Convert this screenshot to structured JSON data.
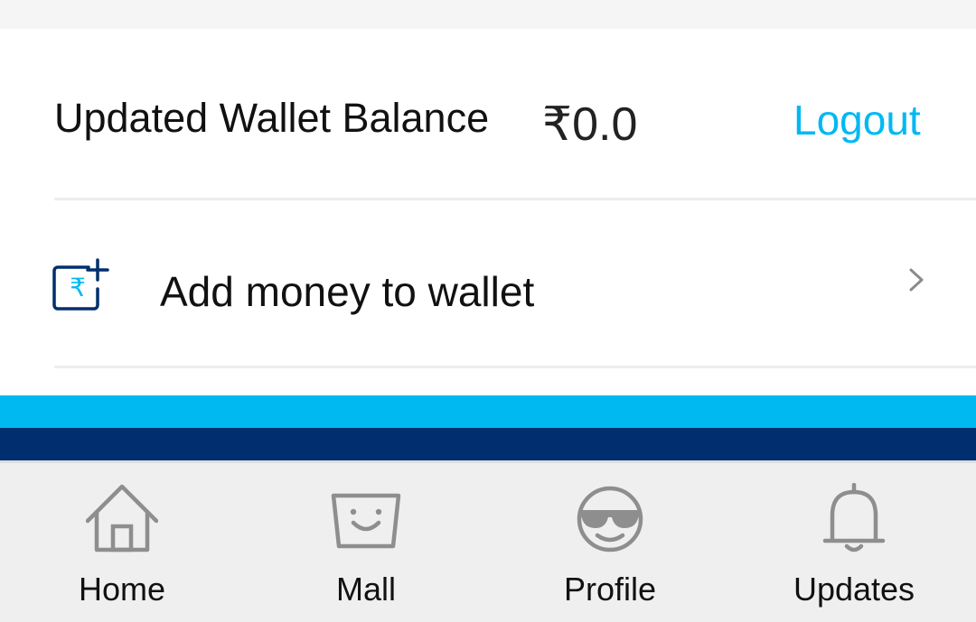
{
  "wallet": {
    "balance_label": "Updated Wallet Balance",
    "balance_value": "₹0.0",
    "logout_label": "Logout",
    "accent_color": "#00b9f1"
  },
  "menu": {
    "add_money_label": "Add money to wallet",
    "add_money_icon": "wallet-add-icon",
    "add_money_icon_glyph": "₹",
    "chevron_icon": "chevron-right-icon"
  },
  "bands": {
    "light_color": "#00b9f1",
    "dark_color": "#002e6e"
  },
  "bottom_nav": {
    "items": [
      {
        "label": "Home",
        "icon": "home-icon"
      },
      {
        "label": "Mall",
        "icon": "shopping-bag-icon"
      },
      {
        "label": "Profile",
        "icon": "sunglasses-face-icon"
      },
      {
        "label": "Updates",
        "icon": "bell-icon"
      }
    ]
  }
}
